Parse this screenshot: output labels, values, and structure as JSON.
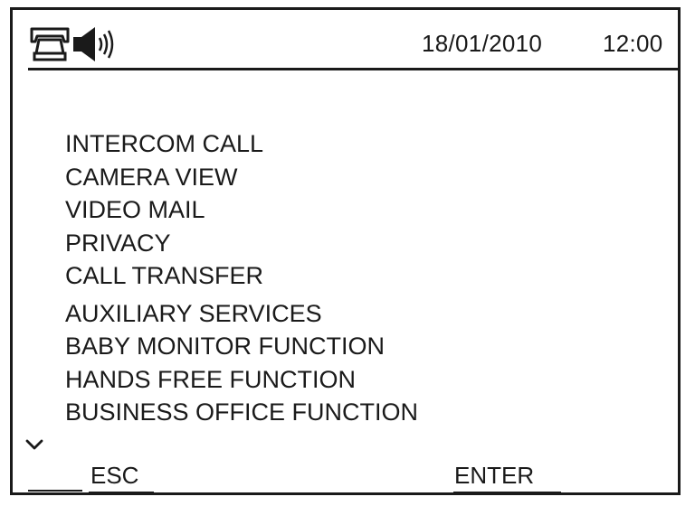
{
  "status_bar": {
    "icons": [
      "telephone-icon",
      "speaker-volume-icon"
    ],
    "date": "18/01/2010",
    "time": "12:00"
  },
  "menu": {
    "items": [
      {
        "label": "INTERCOM CALL"
      },
      {
        "label": "CAMERA VIEW"
      },
      {
        "label": "VIDEO MAIL"
      },
      {
        "label": "PRIVACY"
      },
      {
        "label": "CALL TRANSFER"
      },
      {
        "label": "AUXILIARY SERVICES"
      },
      {
        "label": "BABY MONITOR FUNCTION"
      },
      {
        "label": "HANDS FREE FUNCTION"
      },
      {
        "label": "BUSINESS OFFICE FUNCTION"
      }
    ],
    "scroll_indicator_icon": "chevron-down-icon"
  },
  "softkeys": {
    "esc_label": "ESC",
    "enter_label": "ENTER"
  },
  "colors": {
    "foreground": "#1a1a1a",
    "background": "#ffffff"
  }
}
